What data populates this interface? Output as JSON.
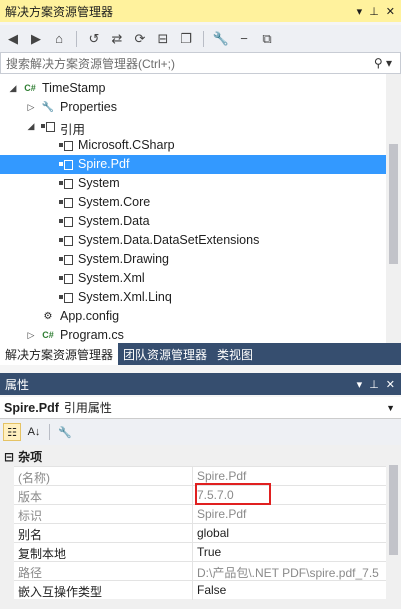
{
  "solution_explorer": {
    "title": "解决方案资源管理器",
    "title_tools": [
      "▾",
      "ꟷ",
      "✕"
    ],
    "search_placeholder": "搜索解决方案资源管理器(Ctrl+;)",
    "tree": [
      {
        "label": "TimeStamp",
        "level": 0,
        "expanded": true,
        "icon": "csharp-project-icon"
      },
      {
        "label": "Properties",
        "level": 1,
        "expanded": false,
        "icon": "wrench-icon"
      },
      {
        "label": "引用",
        "level": 1,
        "expanded": true,
        "icon": "references-icon"
      },
      {
        "label": "Microsoft.CSharp",
        "level": 2,
        "icon": "reference-icon"
      },
      {
        "label": "Spire.Pdf",
        "level": 2,
        "icon": "reference-icon",
        "selected": true
      },
      {
        "label": "System",
        "level": 2,
        "icon": "reference-icon"
      },
      {
        "label": "System.Core",
        "level": 2,
        "icon": "reference-icon"
      },
      {
        "label": "System.Data",
        "level": 2,
        "icon": "reference-icon"
      },
      {
        "label": "System.Data.DataSetExtensions",
        "level": 2,
        "icon": "reference-icon"
      },
      {
        "label": "System.Drawing",
        "level": 2,
        "icon": "reference-icon"
      },
      {
        "label": "System.Xml",
        "level": 2,
        "icon": "reference-icon"
      },
      {
        "label": "System.Xml.Linq",
        "level": 2,
        "icon": "reference-icon"
      },
      {
        "label": "App.config",
        "level": 1,
        "icon": "config-file-icon"
      },
      {
        "label": "Program.cs",
        "level": 1,
        "expanded": false,
        "icon": "csharp-file-icon"
      }
    ]
  },
  "tabs": [
    {
      "label": "解决方案资源管理器",
      "active": true
    },
    {
      "label": "团队资源管理器",
      "active": false
    },
    {
      "label": "类视图",
      "active": false
    }
  ],
  "properties": {
    "title": "属性",
    "object_name": "Spire.Pdf",
    "object_type": "引用属性",
    "category": "杂项",
    "rows": [
      {
        "name": "(名称)",
        "value": "Spire.Pdf",
        "readonly": true
      },
      {
        "name": "版本",
        "value": "7.5.7.0",
        "readonly": true,
        "highlighted": true
      },
      {
        "name": "标识",
        "value": "Spire.Pdf",
        "readonly": true
      },
      {
        "name": "别名",
        "value": "global",
        "readonly": false
      },
      {
        "name": "复制本地",
        "value": "True",
        "readonly": false
      },
      {
        "name": "路径",
        "value": "D:\\产品包\\.NET PDF\\spire.pdf_7.5",
        "readonly": true
      },
      {
        "name": "嵌入互操作类型",
        "value": "False",
        "readonly": false
      }
    ]
  },
  "colors": {
    "selection": "#3399ff",
    "active_title": "#fff29d",
    "tab_bar": "#364e6f",
    "highlight_box": "#e02020"
  }
}
